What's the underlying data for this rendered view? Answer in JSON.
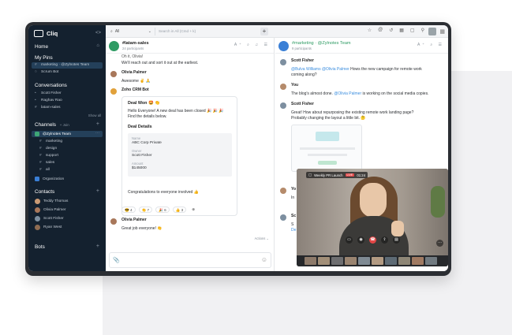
{
  "app": {
    "name": "Cliq"
  },
  "topbar": {
    "scope": "All",
    "search_placeholder": "Search in All (Cmd + k)",
    "add": "+"
  },
  "sidebar": {
    "home": "Home",
    "my_pins": "My Pins",
    "pins": [
      {
        "label": "marketing · @Zylnotes Team"
      },
      {
        "label": "Scrum Bot"
      }
    ],
    "conversations_title": "Conversations",
    "conversations": [
      {
        "label": "Scott Fisher"
      },
      {
        "label": "Raghav Rao"
      },
      {
        "label": "latam-sales"
      }
    ],
    "show_all": "Show all",
    "channels_title": "Channels",
    "channels_join": "+ Join",
    "team": "@Zylnotes Team",
    "channels": [
      {
        "label": "marketing"
      },
      {
        "label": "design"
      },
      {
        "label": "support"
      },
      {
        "label": "sales"
      },
      {
        "label": "all"
      }
    ],
    "organization": "Organization",
    "contacts_title": "Contacts",
    "contacts": [
      {
        "label": "Teddy Thomas"
      },
      {
        "label": "Olivia Palmer"
      },
      {
        "label": "Scott Fisher"
      },
      {
        "label": "Ryan West"
      }
    ],
    "bots_title": "Bots"
  },
  "left_chat": {
    "title": "#latam-sales",
    "subtitle": "24 participants",
    "header_icons": "A⁺ ⌕ ♫ ☰",
    "partial_1": "Oh it, Olivia!",
    "partial_2": "We'll reach out and sort it out at the earliest.",
    "msg1_name": "Olivia Palmer",
    "msg1_text": "Awesome ✌️ 🙏",
    "bot_name": "Zoho CRM Bot",
    "card_title": "Deal Won 🤩 👏",
    "card_line1": "Hello Everyone! A new deal has been closed 🎉 🎉 🎉",
    "card_line2": "Find the details below.",
    "deal_details": "Deal Details",
    "name_label": "Name",
    "name_value": "ABC Corp Private",
    "owner_label": "Owner",
    "owner_value": "Scott Fisher",
    "amount_label": "Amount",
    "amount_value": "$145000",
    "congrats": "Congratulations to everyone involved 👍",
    "reactions": [
      "😎 4",
      "👏 7",
      "🎉 6",
      "👍 3",
      "⊕"
    ],
    "msg2_name": "Olivia Palmer",
    "msg2_text": "Great job everyone! 👏",
    "actions": "Actions ⌄",
    "attach": "📎",
    "emoji": "☺"
  },
  "right_chat": {
    "title": "#marketing · @Zylnotes Team",
    "subtitle": "9 participants",
    "header_icons": "A⁺ ⌕ ☰",
    "m1_name": "Scott Fisher",
    "m1_mention": "@Bulva Williams @Olivia Palmer",
    "m1_text_a": " Hows the new campaign for remote work",
    "m1_text_b": "coming along?",
    "m2_name": "You",
    "m2_text_a": "The blog's almost done.",
    "m2_mention": "@Olivia Palmer",
    "m2_text_b": " is working on the social media copies.",
    "m3_name": "Scott Fisher",
    "m3_text_a": "Great! How about repurposing the existing remote work landing page?",
    "m3_text_b": "Probably changing the layout a little bit. 🤔",
    "partial_you": "Yo",
    "partial_in": "In",
    "partial_sc": "Sc",
    "partial_s": "S",
    "partial_de": "De"
  },
  "video": {
    "meeting": "Weekly PR Launch",
    "live": "LIVE",
    "timer": "01:24",
    "controls": [
      "▭",
      "◉",
      "☎",
      "⇪",
      "▤"
    ],
    "more": "···"
  },
  "colors": {
    "sidebar": "#14212f",
    "accent": "#3a8dde",
    "end_call": "#e24646",
    "team_tag": "#3ea676"
  }
}
